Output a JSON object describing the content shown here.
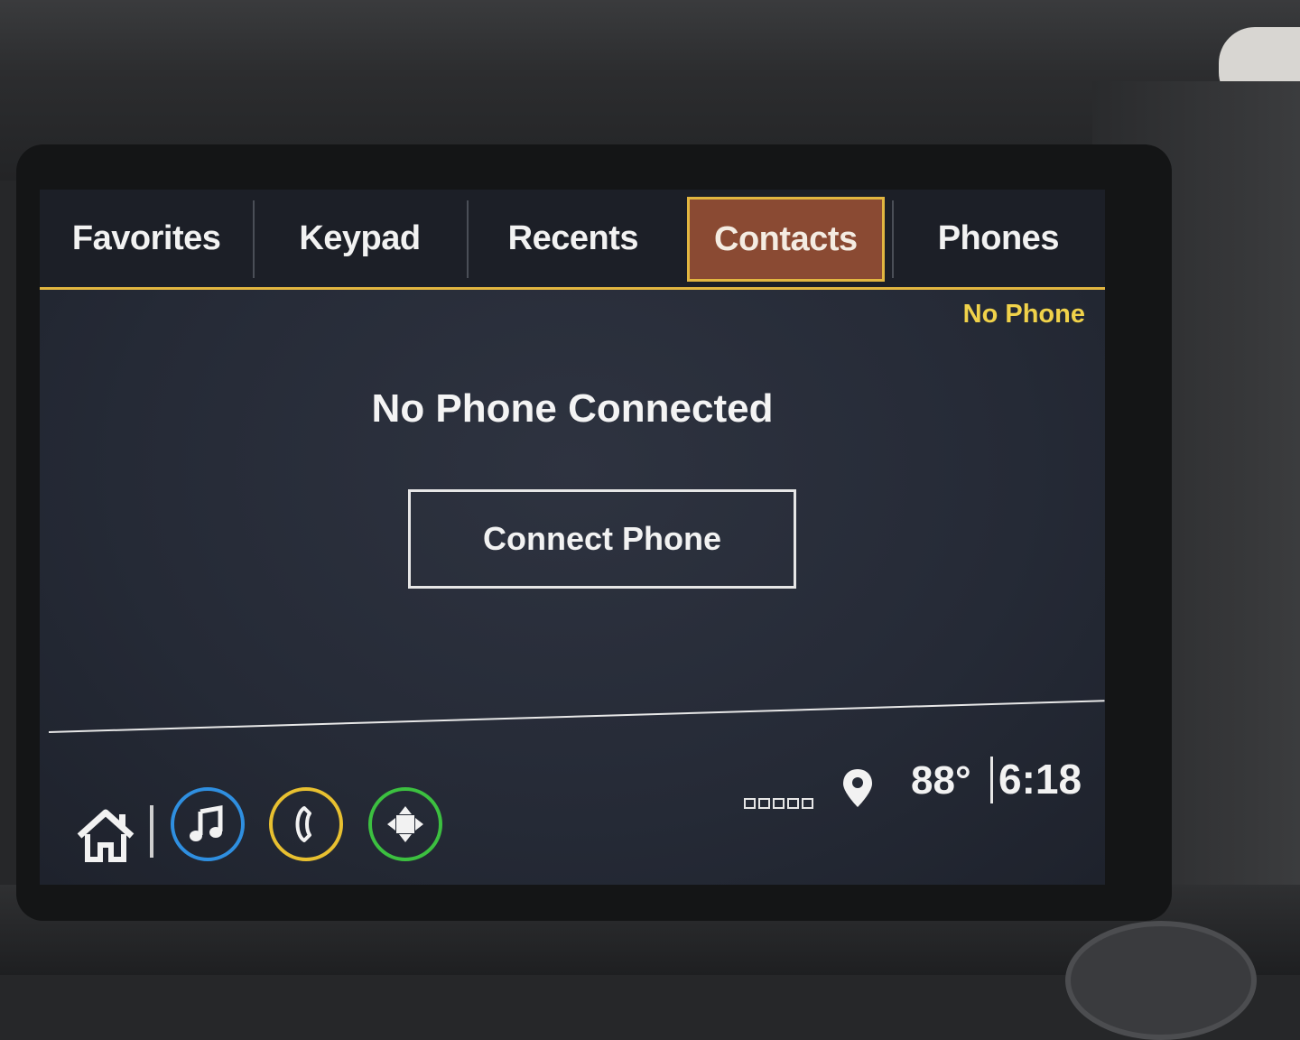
{
  "tabs": [
    {
      "label": "Favorites",
      "active": false
    },
    {
      "label": "Keypad",
      "active": false
    },
    {
      "label": "Recents",
      "active": false
    },
    {
      "label": "Contacts",
      "active": true
    },
    {
      "label": "Phones",
      "active": false
    }
  ],
  "status_label": "No Phone",
  "main": {
    "title": "No Phone Connected",
    "connect_button": "Connect Phone"
  },
  "statusbar": {
    "temperature": "88°",
    "time": "6:18",
    "signal_bars": 5
  },
  "bottom_nav": [
    {
      "icon": "home-icon"
    },
    {
      "icon": "music-note-icon",
      "ring_color": "#2f8fe0"
    },
    {
      "icon": "phone-icon",
      "ring_color": "#e8c030"
    },
    {
      "icon": "apps-icon",
      "ring_color": "#3cc040"
    }
  ],
  "colors": {
    "accent": "#e2b640",
    "active_tab": "#8a4a33",
    "status_text": "#f0d24a"
  }
}
